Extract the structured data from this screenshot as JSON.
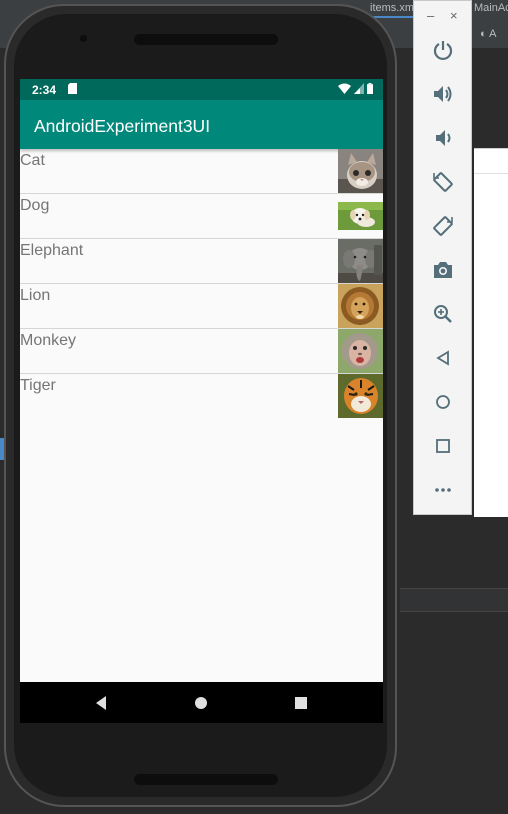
{
  "ide": {
    "tab_items": "items.xml",
    "tab_main": "MainActivity",
    "right_toolbar_label": "A"
  },
  "emulator_toolbar": {
    "minimize": "–",
    "close": "×",
    "buttons": [
      "power",
      "volume-up",
      "volume-down",
      "rotate-left",
      "rotate-right",
      "screenshot",
      "zoom",
      "back",
      "home",
      "overview",
      "more"
    ]
  },
  "status_bar": {
    "time": "2:34"
  },
  "app_bar": {
    "title": "AndroidExperiment3UI"
  },
  "animals": [
    {
      "label": "Cat",
      "image": "cat-photo"
    },
    {
      "label": "Dog",
      "image": "dog-photo"
    },
    {
      "label": "Elephant",
      "image": "elephant-photo"
    },
    {
      "label": "Lion",
      "image": "lion-photo"
    },
    {
      "label": "Monkey",
      "image": "monkey-photo"
    },
    {
      "label": "Tiger",
      "image": "tiger-photo"
    }
  ],
  "colors": {
    "status_bar": "#00695c",
    "app_bar": "#00897b",
    "list_text": "#757575"
  }
}
